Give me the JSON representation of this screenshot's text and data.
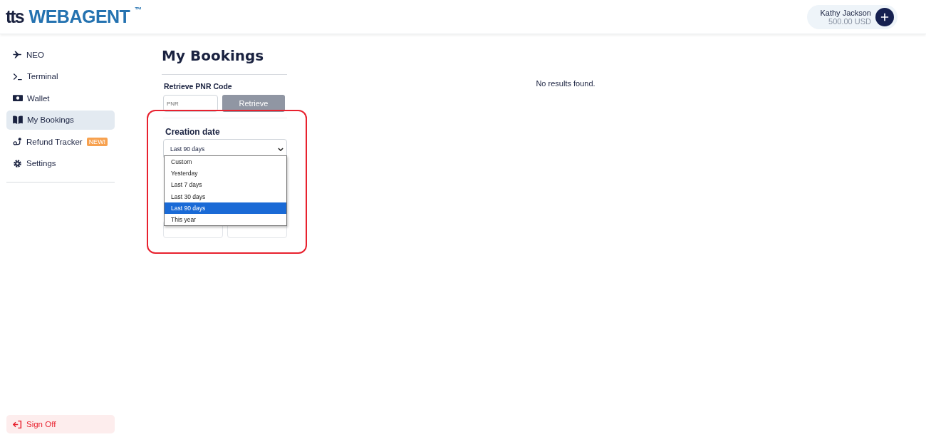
{
  "header": {
    "logo_prefix": "tts",
    "logo_main": "WEBAGENT",
    "logo_mark": "™",
    "user": {
      "name": "Kathy Jackson",
      "balance": "500.00 USD"
    }
  },
  "sidebar": {
    "items": [
      {
        "label": "NEO",
        "selected": false
      },
      {
        "label": "Terminal",
        "selected": false
      },
      {
        "label": "Wallet",
        "selected": false
      },
      {
        "label": "My Bookings",
        "selected": true
      },
      {
        "label": "Refund Tracker",
        "selected": false,
        "badge": "NEW!"
      },
      {
        "label": "Settings",
        "selected": false
      }
    ],
    "sign_off": "Sign Off"
  },
  "page": {
    "title": "My Bookings",
    "retrieve": {
      "label": "Retrieve PNR Code",
      "placeholder": "PNR",
      "button": "Retrieve"
    },
    "creation_date": {
      "label": "Creation date",
      "value": "Last 90 days",
      "expanded": true,
      "options": [
        {
          "label": "Custom",
          "selected": false
        },
        {
          "label": "Yesterday",
          "selected": false
        },
        {
          "label": "Last 7 days",
          "selected": false
        },
        {
          "label": "Last 30 days",
          "selected": false
        },
        {
          "label": "Last 90 days",
          "selected": true
        },
        {
          "label": "This year",
          "selected": false
        }
      ]
    },
    "results_message": "No results found."
  }
}
